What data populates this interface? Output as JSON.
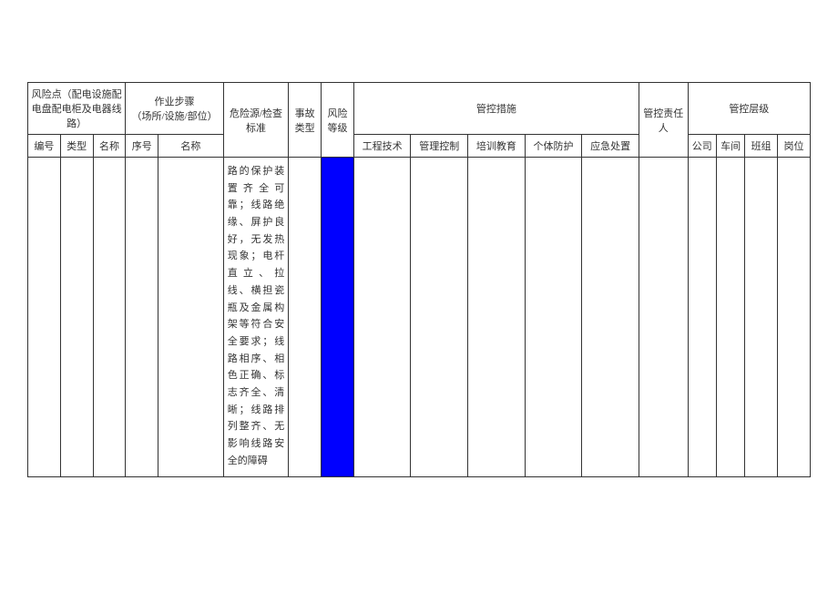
{
  "headers": {
    "risk_point": "风险点（配电设施配电盘配电柜及电器线路）",
    "risk_point_sub": {
      "no": "编号",
      "type": "类型",
      "name": "名称"
    },
    "work_step": "作业步骤\n（场所/设施/部位）",
    "work_step_sub": {
      "no": "序号",
      "name": "名称"
    },
    "hazard": "危险源/检查标准",
    "accident": "事故类型",
    "risk_level": "风险等级",
    "measures": "管控措施",
    "measures_sub": {
      "eng": "工程技术",
      "mgmt": "管理控制",
      "train": "培训教育",
      "ppe": "个体防护",
      "emerg": "应急处置"
    },
    "responsible": "管控责任人",
    "levels": "管控层级",
    "levels_sub": {
      "company": "公司",
      "workshop": "车间",
      "team": "班组",
      "post": "岗位"
    }
  },
  "row": {
    "hazard_text": "路的保护装置齐全可靠；线路绝缘、屏护良好，无发热现象；电杆直立、拉线、横担瓷瓶及金属构架等符合安全要求；线路相序、相色正确、标志齐全、清晰；线路排列整齐、无影响线路安全的障碍"
  }
}
